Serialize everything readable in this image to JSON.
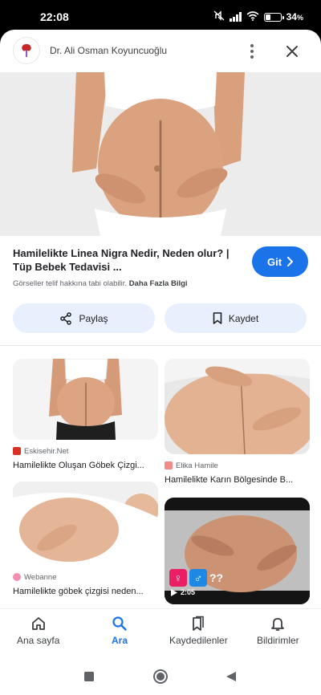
{
  "status_bar": {
    "time": "22:08",
    "battery": "34",
    "battery_unit": "%",
    "battery_level": 0.34
  },
  "header": {
    "site_name": "Dr. Ali Osman Koyuncuoğlu"
  },
  "result": {
    "title": "Hamilelikte Linea Nigra Nedir, Neden olur? | Tüp Bebek Tedavisi ...",
    "visit_label": "Git",
    "copyright_text": "Görseller telif hakkına tabi olabilir.",
    "more_info_link": "Daha Fazla Bilgi"
  },
  "actions": {
    "share_label": "Paylaş",
    "save_label": "Kaydet"
  },
  "related": [
    {
      "source": "Eskisehir.Net",
      "caption": "Hamilelikte Oluşan Göbek Çizgi...",
      "favicon_color": "#d93025"
    },
    {
      "source": "Elika Hamile",
      "caption": "Hamilelikte Karın Bölgesinde B...",
      "favicon_color": "#f28b82"
    },
    {
      "source": "Webanne",
      "caption": "Hamilelikte göbek çizgisi neden...",
      "favicon_color": "#f48fb1"
    },
    {
      "duration": "2:05",
      "overlay_text": "??",
      "symbols": [
        "♀",
        "♂"
      ]
    }
  ],
  "bottom_nav": [
    {
      "label": "Ana sayfa",
      "icon": "home-icon"
    },
    {
      "label": "Ara",
      "icon": "search-icon",
      "active": true
    },
    {
      "label": "Kaydedilenler",
      "icon": "bookmarks-icon"
    },
    {
      "label": "Bildirimler",
      "icon": "bell-icon"
    }
  ],
  "colors": {
    "accent": "#1a73e8",
    "chip_bg": "#e8f0fe"
  }
}
